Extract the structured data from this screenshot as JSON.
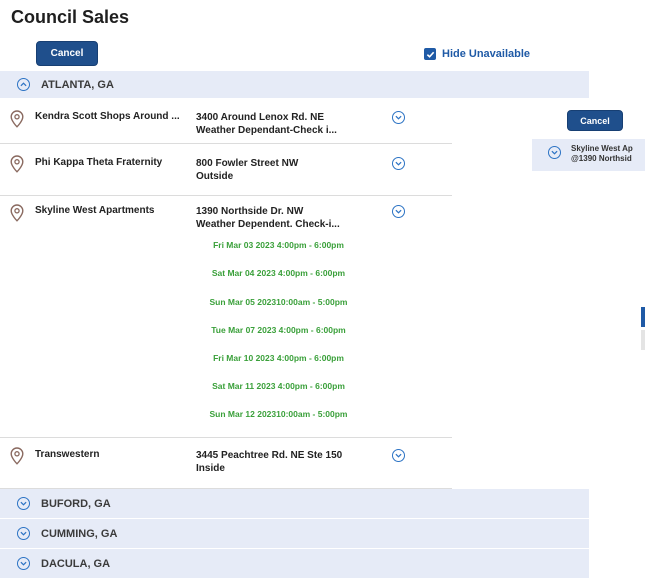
{
  "page": {
    "title": "Council Sales"
  },
  "toolbar": {
    "cancel_label": "Cancel",
    "hide_unavailable_label": "Hide Unavailable",
    "hide_unavailable_checked": true
  },
  "regions": [
    {
      "name": "ATLANTA, GA",
      "expanded": true
    },
    {
      "name": "BUFORD, GA",
      "expanded": false
    },
    {
      "name": "CUMMING, GA",
      "expanded": false
    },
    {
      "name": "DACULA, GA",
      "expanded": false
    }
  ],
  "locations": [
    {
      "name": "Kendra Scott Shops Around ...",
      "address": "3400 Around Lenox Rd. NE",
      "note": "Weather Dependant-Check i..."
    },
    {
      "name": "Phi Kappa Theta Fraternity",
      "address": "800 Fowler Street NW",
      "note": "Outside"
    },
    {
      "name": "Skyline West Apartments",
      "address": "1390 Northside Dr. NW",
      "note": "Weather Dependent. Check-i..."
    },
    {
      "name": "Transwestern",
      "address": "3445 Peachtree Rd. NE Ste 150",
      "note": "Inside"
    }
  ],
  "time_slots": [
    "Fri Mar 03 2023 4:00pm - 6:00pm",
    "Sat Mar 04 2023 4:00pm - 6:00pm",
    "Sun Mar 05 202310:00am - 5:00pm",
    "Tue Mar 07 2023 4:00pm - 6:00pm",
    "Fri Mar 10 2023 4:00pm - 6:00pm",
    "Sat Mar 11 2023 4:00pm - 6:00pm",
    "Sun Mar 12 202310:00am - 5:00pm"
  ],
  "side_panel": {
    "cancel_label": "Cancel",
    "line1": "Skyline West Ap",
    "line2": "@1390 Northsid"
  },
  "colors": {
    "primary": "#1f4f8c",
    "link": "#1f5aa6",
    "region_bg": "#e6ebf7",
    "slot_green": "#3aa03a"
  },
  "icons": {
    "location": "map-pin-icon",
    "expand": "chevron-circle-down-icon",
    "collapse": "chevron-circle-up-icon",
    "check": "check-icon"
  }
}
